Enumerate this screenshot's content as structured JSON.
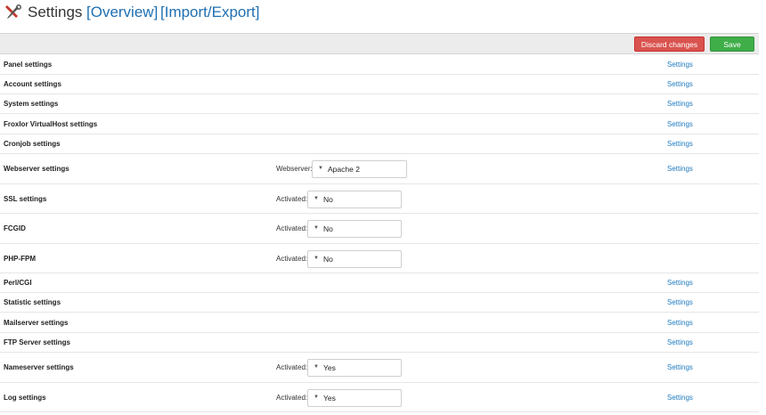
{
  "header": {
    "title": "Settings",
    "links": [
      "[Overview]",
      "[Import/Export]"
    ]
  },
  "toolbar": {
    "discard_label": "Discard changes",
    "save_label": "Save"
  },
  "colors": {
    "link": "#1f7bc1",
    "discard": "#d9534f",
    "save": "#3fae49"
  },
  "rows": [
    {
      "name": "Panel settings",
      "settings_link": "Settings"
    },
    {
      "name": "Account settings",
      "settings_link": "Settings"
    },
    {
      "name": "System settings",
      "settings_link": "Settings"
    },
    {
      "name": "Froxlor VirtualHost settings",
      "settings_link": "Settings"
    },
    {
      "name": "Cronjob settings",
      "settings_link": "Settings"
    },
    {
      "name": "Webserver settings",
      "option_label": "Webserver:",
      "option_value": "Apache 2",
      "settings_link": "Settings"
    },
    {
      "name": "SSL settings",
      "option_label": "Activated:",
      "option_value": "No",
      "settings_link": ""
    },
    {
      "name": "FCGID",
      "option_label": "Activated:",
      "option_value": "No",
      "settings_link": ""
    },
    {
      "name": "PHP-FPM",
      "option_label": "Activated:",
      "option_value": "No",
      "settings_link": ""
    },
    {
      "name": "Perl/CGI",
      "settings_link": "Settings"
    },
    {
      "name": "Statistic settings",
      "settings_link": "Settings"
    },
    {
      "name": "Mailserver settings",
      "settings_link": "Settings"
    },
    {
      "name": "FTP Server settings",
      "settings_link": "Settings"
    },
    {
      "name": "Nameserver settings",
      "option_label": "Activated:",
      "option_value": "Yes",
      "settings_link": "Settings"
    },
    {
      "name": "Log settings",
      "option_label": "Activated:",
      "option_value": "Yes",
      "settings_link": "Settings"
    }
  ]
}
